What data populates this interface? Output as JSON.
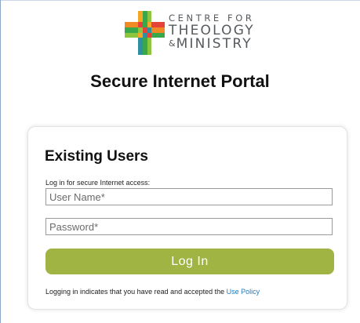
{
  "colors": {
    "accent": "#a0b443",
    "link": "#1f7bc0",
    "logo_orange": "#f08a24",
    "logo_green": "#39a84a",
    "logo_red": "#e5433a",
    "logo_teal": "#2f8fa0"
  },
  "logo": {
    "line1": "CENTRE FOR",
    "line2": "THEOLOGY",
    "line3_amp": "&",
    "line3": "MINISTRY",
    "icon": "cross-mosaic-icon"
  },
  "header": {
    "title": "Secure Internet Portal"
  },
  "login": {
    "title": "Existing Users",
    "subtitle": "Log in for secure Internet access:",
    "username_placeholder": "User Name*",
    "password_placeholder": "Password*",
    "button_label": "Log In",
    "policy_text": "Logging in indicates that you have read and accepted the ",
    "policy_link": "Use Policy"
  }
}
